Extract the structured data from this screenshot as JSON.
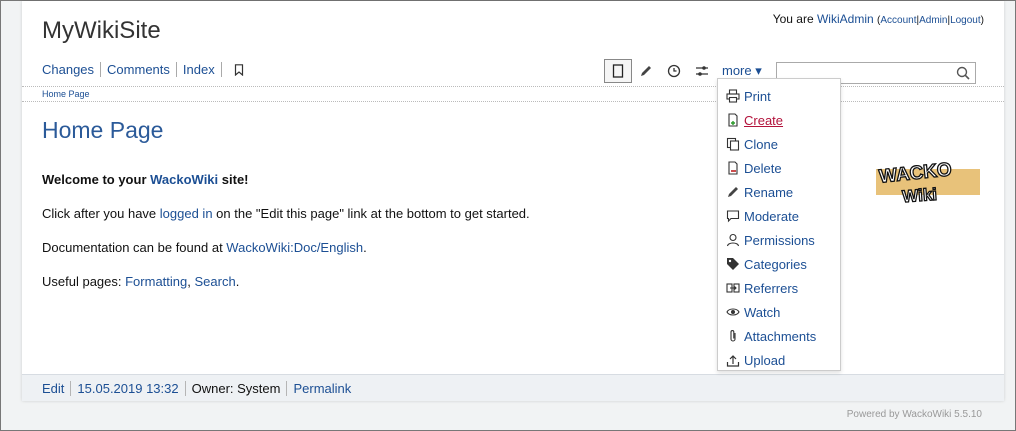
{
  "header": {
    "site_title": "MyWikiSite",
    "user_prefix": "You are",
    "user_name": "WikiAdmin",
    "links": [
      "Account",
      "Admin",
      "Logout"
    ]
  },
  "nav": {
    "items": [
      "Changes",
      "Comments",
      "Index"
    ]
  },
  "toolbar": {
    "more_label": "more ▾",
    "search_placeholder": ""
  },
  "breadcrumb": "Home Page",
  "content": {
    "heading": "Home Page",
    "p1_pre": "Welcome to your ",
    "p1_link": "WackoWiki",
    "p1_post": " site!",
    "p2_pre": "Click after you have ",
    "p2_link": "logged in",
    "p2_post": " on the \"Edit this page\" link at the bottom to get started.",
    "p3_pre": "Documentation can be found at ",
    "p3_link": "WackoWiki:Doc/English",
    "p3_post": ".",
    "p4_pre": "Useful pages: ",
    "p4_link1": "Formatting",
    "p4_mid": ", ",
    "p4_link2": "Search",
    "p4_post": "."
  },
  "logo": {
    "line1": "WACKO",
    "line2": "Wiki"
  },
  "footer": {
    "edit": "Edit",
    "date": "15.05.2019 13:32",
    "owner": "Owner: System",
    "permalink": "Permalink"
  },
  "powered_by": "Powered by WackoWiki 5.5.10",
  "dropdown": {
    "items": [
      {
        "label": "Print",
        "icon": "printer-icon"
      },
      {
        "label": "Create",
        "icon": "create-page-icon"
      },
      {
        "label": "Clone",
        "icon": "clone-icon"
      },
      {
        "label": "Delete",
        "icon": "delete-page-icon"
      },
      {
        "label": "Rename",
        "icon": "pencil-icon"
      },
      {
        "label": "Moderate",
        "icon": "speech-bubble-icon"
      },
      {
        "label": "Permissions",
        "icon": "user-icon"
      },
      {
        "label": "Categories",
        "icon": "tag-icon"
      },
      {
        "label": "Referrers",
        "icon": "referrer-icon"
      },
      {
        "label": "Watch",
        "icon": "eye-icon"
      },
      {
        "label": "Attachments",
        "icon": "paperclip-icon"
      },
      {
        "label": "Upload",
        "icon": "upload-icon"
      }
    ]
  },
  "colors": {
    "link": "#1c4f94",
    "heading": "#2b5a99",
    "hover": "#b3123b",
    "logo_bg": "#e8c27a"
  }
}
